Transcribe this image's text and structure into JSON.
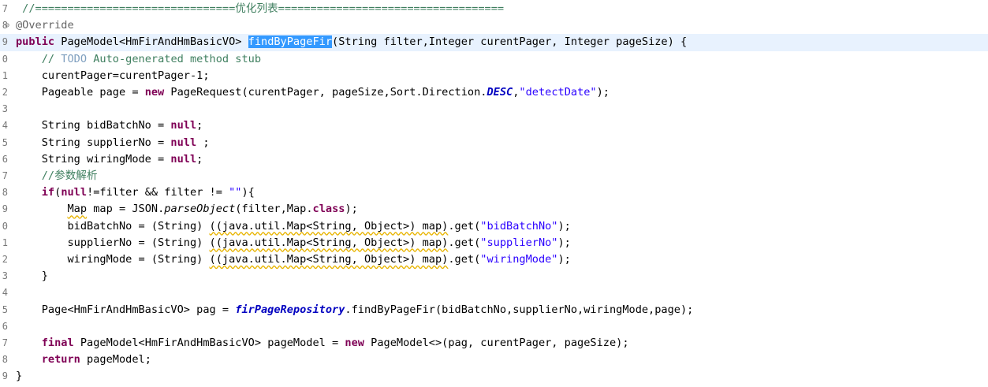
{
  "editor": {
    "lines": [
      {
        "num": "7",
        "fold": "",
        "segments": [
          {
            "t": " //===============================",
            "c": "cm"
          },
          {
            "t": "优化列表",
            "c": "cm cjk"
          },
          {
            "t": "===================================",
            "c": "cm"
          }
        ]
      },
      {
        "num": "8",
        "fold": "⊖",
        "segments": [
          {
            "t": "@Override",
            "c": "ann"
          }
        ]
      },
      {
        "num": "9",
        "fold": "",
        "current": true,
        "segments": [
          {
            "t": "public",
            "c": "kw"
          },
          {
            "t": " PageModel<HmFirAndHmBasicVO> ",
            "c": ""
          },
          {
            "t": "findByPageFir",
            "c": "sel"
          },
          {
            "t": "(String filter,Integer curentPager, Integer pageSize) {",
            "c": ""
          }
        ]
      },
      {
        "num": "0",
        "fold": "",
        "segments": [
          {
            "t": "    // ",
            "c": "cm"
          },
          {
            "t": "TODO",
            "c": "cm-todo"
          },
          {
            "t": " Auto-generated method stub",
            "c": "cm"
          }
        ]
      },
      {
        "num": "1",
        "fold": "",
        "segments": [
          {
            "t": "    curentPager=curentPager-1;",
            "c": ""
          }
        ]
      },
      {
        "num": "2",
        "fold": "",
        "segments": [
          {
            "t": "    Pageable page = ",
            "c": ""
          },
          {
            "t": "new",
            "c": "kw"
          },
          {
            "t": " PageRequest(curentPager, pageSize,Sort.Direction.",
            "c": ""
          },
          {
            "t": "DESC",
            "c": "st"
          },
          {
            "t": ",",
            "c": ""
          },
          {
            "t": "\"detectDate\"",
            "c": "str"
          },
          {
            "t": ");",
            "c": ""
          }
        ]
      },
      {
        "num": "3",
        "fold": "",
        "segments": [
          {
            "t": "",
            "c": ""
          }
        ]
      },
      {
        "num": "4",
        "fold": "",
        "segments": [
          {
            "t": "    String bidBatchNo = ",
            "c": ""
          },
          {
            "t": "null",
            "c": "kw"
          },
          {
            "t": ";",
            "c": ""
          }
        ]
      },
      {
        "num": "5",
        "fold": "",
        "segments": [
          {
            "t": "    String supplierNo = ",
            "c": ""
          },
          {
            "t": "null",
            "c": "kw"
          },
          {
            "t": " ;",
            "c": ""
          }
        ]
      },
      {
        "num": "6",
        "fold": "",
        "segments": [
          {
            "t": "    String wiringMode = ",
            "c": ""
          },
          {
            "t": "null",
            "c": "kw"
          },
          {
            "t": ";",
            "c": ""
          }
        ]
      },
      {
        "num": "7",
        "fold": "",
        "segments": [
          {
            "t": "    //",
            "c": "cm"
          },
          {
            "t": "参数解析",
            "c": "cm cjk"
          }
        ]
      },
      {
        "num": "8",
        "fold": "",
        "segments": [
          {
            "t": "    ",
            "c": ""
          },
          {
            "t": "if",
            "c": "kw"
          },
          {
            "t": "(",
            "c": ""
          },
          {
            "t": "null",
            "c": "kw"
          },
          {
            "t": "!=filter && filter != ",
            "c": ""
          },
          {
            "t": "\"\"",
            "c": "str"
          },
          {
            "t": "){",
            "c": ""
          }
        ]
      },
      {
        "num": "9",
        "fold": "",
        "segments": [
          {
            "t": "        ",
            "c": ""
          },
          {
            "t": "Map",
            "c": "wv"
          },
          {
            "t": " map = JSON.",
            "c": ""
          },
          {
            "t": "parseObject",
            "c": "it"
          },
          {
            "t": "(filter,Map.",
            "c": ""
          },
          {
            "t": "class",
            "c": "kw"
          },
          {
            "t": ");",
            "c": ""
          }
        ]
      },
      {
        "num": "0",
        "fold": "",
        "segments": [
          {
            "t": "        bidBatchNo = (String) ",
            "c": ""
          },
          {
            "t": "((java.util.Map<String, Object>) map)",
            "c": "wv"
          },
          {
            "t": ".get(",
            "c": ""
          },
          {
            "t": "\"bidBatchNo\"",
            "c": "str"
          },
          {
            "t": ");",
            "c": ""
          }
        ]
      },
      {
        "num": "1",
        "fold": "",
        "segments": [
          {
            "t": "        supplierNo = (String) ",
            "c": ""
          },
          {
            "t": "((java.util.Map<String, Object>) map)",
            "c": "wv"
          },
          {
            "t": ".get(",
            "c": ""
          },
          {
            "t": "\"supplierNo\"",
            "c": "str"
          },
          {
            "t": ");",
            "c": ""
          }
        ]
      },
      {
        "num": "2",
        "fold": "",
        "segments": [
          {
            "t": "        wiringMode = (String) ",
            "c": ""
          },
          {
            "t": "((java.util.Map<String, Object>) map)",
            "c": "wv"
          },
          {
            "t": ".get(",
            "c": ""
          },
          {
            "t": "\"wiringMode\"",
            "c": "str"
          },
          {
            "t": ");",
            "c": ""
          }
        ]
      },
      {
        "num": "3",
        "fold": "",
        "segments": [
          {
            "t": "    }",
            "c": ""
          }
        ]
      },
      {
        "num": "4",
        "fold": "",
        "segments": [
          {
            "t": "",
            "c": ""
          }
        ]
      },
      {
        "num": "5",
        "fold": "",
        "segments": [
          {
            "t": "    Page<HmFirAndHmBasicVO> pag = ",
            "c": ""
          },
          {
            "t": "firPageRepository",
            "c": "st"
          },
          {
            "t": ".findByPageFir(bidBatchNo,supplierNo,wiringMode,page);",
            "c": ""
          }
        ]
      },
      {
        "num": "6",
        "fold": "",
        "segments": [
          {
            "t": "",
            "c": ""
          }
        ]
      },
      {
        "num": "7",
        "fold": "",
        "segments": [
          {
            "t": "    ",
            "c": ""
          },
          {
            "t": "final",
            "c": "kw"
          },
          {
            "t": " PageModel<HmFirAndHmBasicVO> pageModel = ",
            "c": ""
          },
          {
            "t": "new",
            "c": "kw"
          },
          {
            "t": " PageModel<>(pag, curentPager, pageSize);",
            "c": ""
          }
        ]
      },
      {
        "num": "8",
        "fold": "",
        "segments": [
          {
            "t": "    ",
            "c": ""
          },
          {
            "t": "return",
            "c": "kw"
          },
          {
            "t": " pageModel;",
            "c": ""
          }
        ]
      },
      {
        "num": "9",
        "fold": "",
        "segments": [
          {
            "t": "}",
            "c": ""
          }
        ]
      }
    ]
  }
}
